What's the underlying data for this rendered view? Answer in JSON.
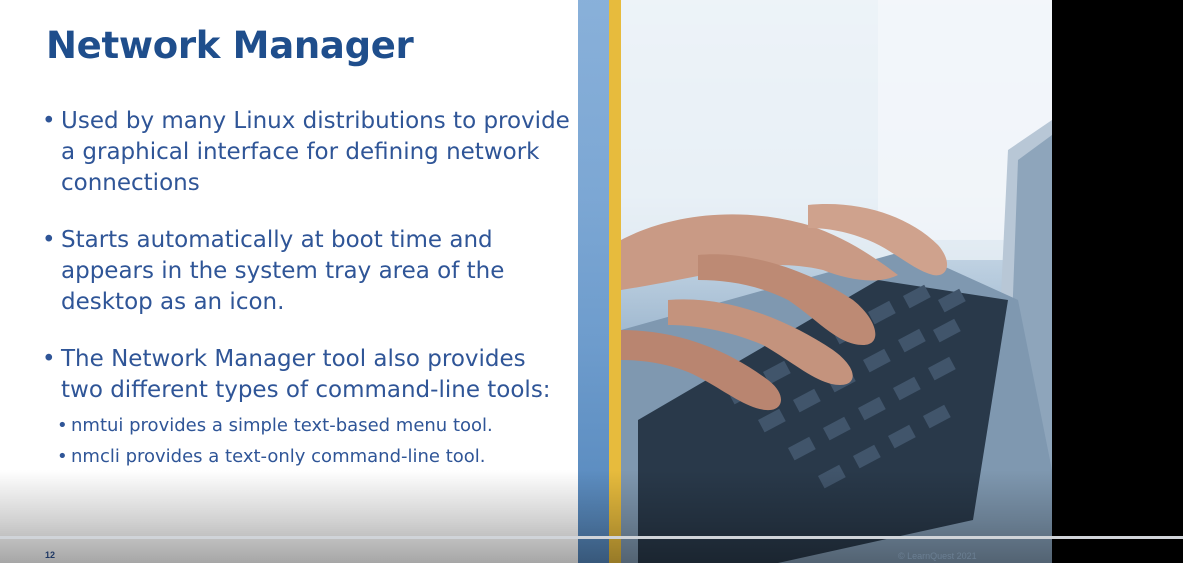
{
  "slide": {
    "title": "Network Manager",
    "bullets": [
      {
        "text": "Used by many Linux distributions to provide a graphical interface for defining network connections"
      },
      {
        "text": "Starts automatically at boot time and appears in the system tray area of the desktop as an icon."
      },
      {
        "text": "The Network Manager tool also provides two different types of command-line tools:",
        "sub": [
          {
            "text": "nmtui provides a simple text-based menu tool."
          },
          {
            "text": "nmcli provides a text-only command-line tool."
          }
        ]
      }
    ],
    "page_number": "12",
    "copyright": "© LearnQuest 2021",
    "image": "laptop-typing-photo"
  },
  "player": {
    "progress_fraction": 1.0
  },
  "colors": {
    "title": "#1f4e8c",
    "body": "#2f5597",
    "gold_stripe": "#e7bb3d",
    "blue_stripe": "#5b8fc6"
  }
}
